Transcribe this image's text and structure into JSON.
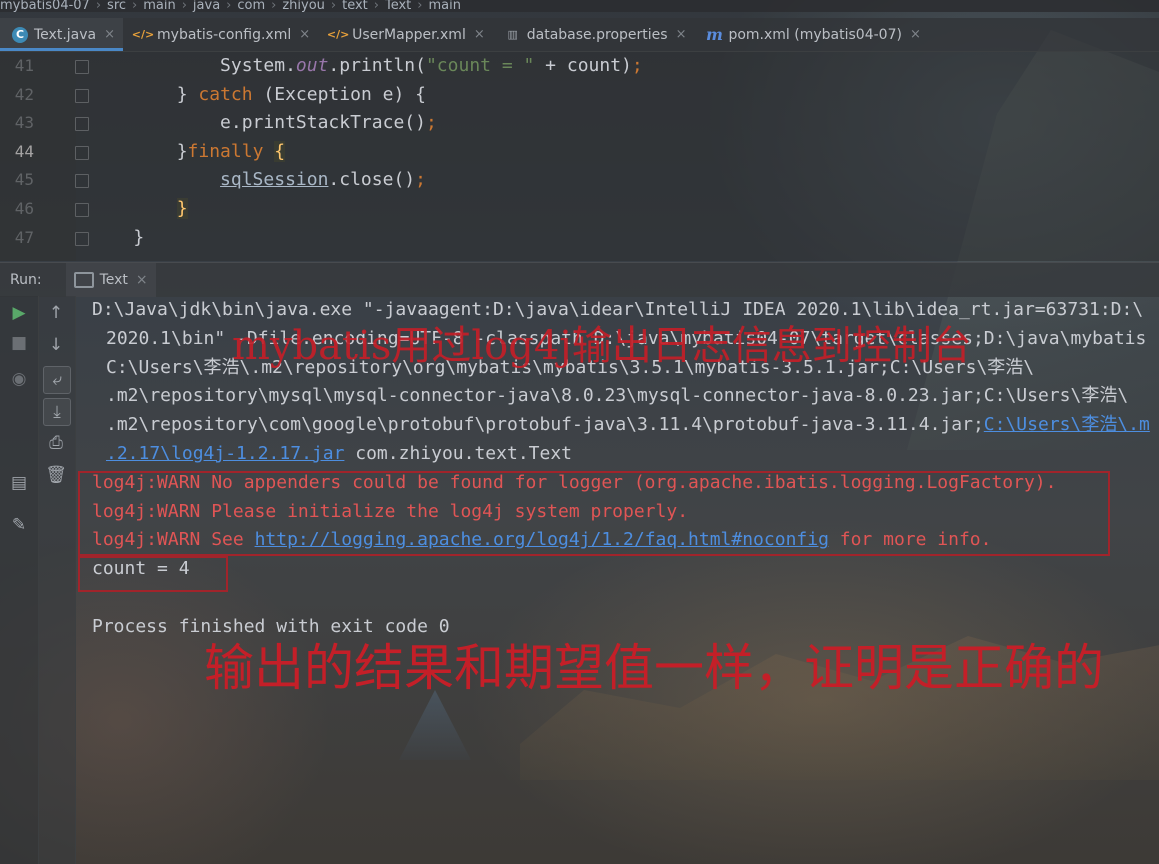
{
  "breadcrumb": {
    "items": [
      "mybatis04-07",
      "src",
      "main",
      "java",
      "com",
      "zhiyou",
      "text",
      "Text",
      "main"
    ]
  },
  "tabs": [
    {
      "label": "Text.java",
      "icon": "java-class-icon",
      "active": true
    },
    {
      "label": "mybatis-config.xml",
      "icon": "xml-file-icon"
    },
    {
      "label": "UserMapper.xml",
      "icon": "xml-file-icon"
    },
    {
      "label": "database.properties",
      "icon": "properties-file-icon"
    },
    {
      "label": "pom.xml (mybatis04-07)",
      "icon": "maven-icon"
    }
  ],
  "editor": {
    "lines": [
      {
        "num": "41",
        "indent": "            ",
        "tokens": [
          [
            "System.",
            ""
          ],
          [
            "out",
            "fld"
          ],
          [
            ".println(",
            ""
          ],
          [
            "\"count = \"",
            "st"
          ],
          [
            " + count)",
            ""
          ],
          [
            ";",
            "kw"
          ]
        ]
      },
      {
        "num": "42",
        "indent": "        ",
        "tokens": [
          [
            "} ",
            ""
          ],
          [
            "catch",
            "kw"
          ],
          [
            " (Exception e) {",
            ""
          ]
        ]
      },
      {
        "num": "43",
        "indent": "            ",
        "tokens": [
          [
            "e.printStackTrace()",
            ""
          ],
          [
            ";",
            "kw"
          ]
        ]
      },
      {
        "num": "44",
        "indent": "        ",
        "current": true,
        "tokens": [
          [
            "}",
            ""
          ],
          [
            "finally",
            "kw"
          ],
          [
            " ",
            ""
          ],
          [
            "{",
            "yel"
          ]
        ]
      },
      {
        "num": "45",
        "indent": "            ",
        "tokens": [
          [
            "sqlSession",
            "var-ul"
          ],
          [
            ".close()",
            ""
          ],
          [
            ";",
            "kw"
          ]
        ]
      },
      {
        "num": "46",
        "indent": "        ",
        "tokens": [
          [
            "}",
            "yel"
          ]
        ]
      },
      {
        "num": "47",
        "indent": "    ",
        "tokens": [
          [
            "}",
            ""
          ]
        ]
      }
    ]
  },
  "run": {
    "label": "Run:",
    "tab": "Text"
  },
  "console": {
    "cmd1": "D:\\Java\\jdk\\bin\\java.exe \"-javaagent:D:\\java\\idear\\IntelliJ IDEA 2020.1\\lib\\idea_rt.jar=63731:D:\\",
    "cmd2": "2020.1\\bin\" -Dfile.encoding=UTF-8 -classpath D:\\java\\mybatis04-07\\target\\classes;D:\\java\\mybatis",
    "cmd3": "C:\\Users\\李浩\\.m2\\repository\\org\\mybatis\\mybatis\\3.5.1\\mybatis-3.5.1.jar;C:\\Users\\李浩\\",
    "cmd4": ".m2\\repository\\mysql\\mysql-connector-java\\8.0.23\\mysql-connector-java-8.0.23.jar;C:\\Users\\李浩\\",
    "cmd5a": ".m2\\repository\\com\\google\\protobuf\\protobuf-java\\3.11.4\\protobuf-java-3.11.4.jar;",
    "cmd5b": "C:\\Users\\李浩\\.m",
    "cmd6a": ".2.17\\log4j-1.2.17.jar",
    "cmd6b": " com.zhiyou.text.Text",
    "warn1": "log4j:WARN No appenders could be found for logger (org.apache.ibatis.logging.LogFactory).",
    "warn2": "log4j:WARN Please initialize the log4j system properly.",
    "warn3a": "log4j:WARN See ",
    "warn3link": "http://logging.apache.org/log4j/1.2/faq.html#noconfig",
    "warn3b": " for more info.",
    "count": "count = 4",
    "exit": "Process finished with exit code 0"
  },
  "annotations": {
    "top": "mybatis用过log4j输出日志信息到控制台",
    "bottom": "输出的结果和期望值一样，证明是正确的"
  },
  "colors": {
    "accent": "#4a88c7",
    "error_text": "#e05555",
    "annotation_red": "#c41f28",
    "keyword": "#cc7832",
    "string": "#6a8759"
  }
}
